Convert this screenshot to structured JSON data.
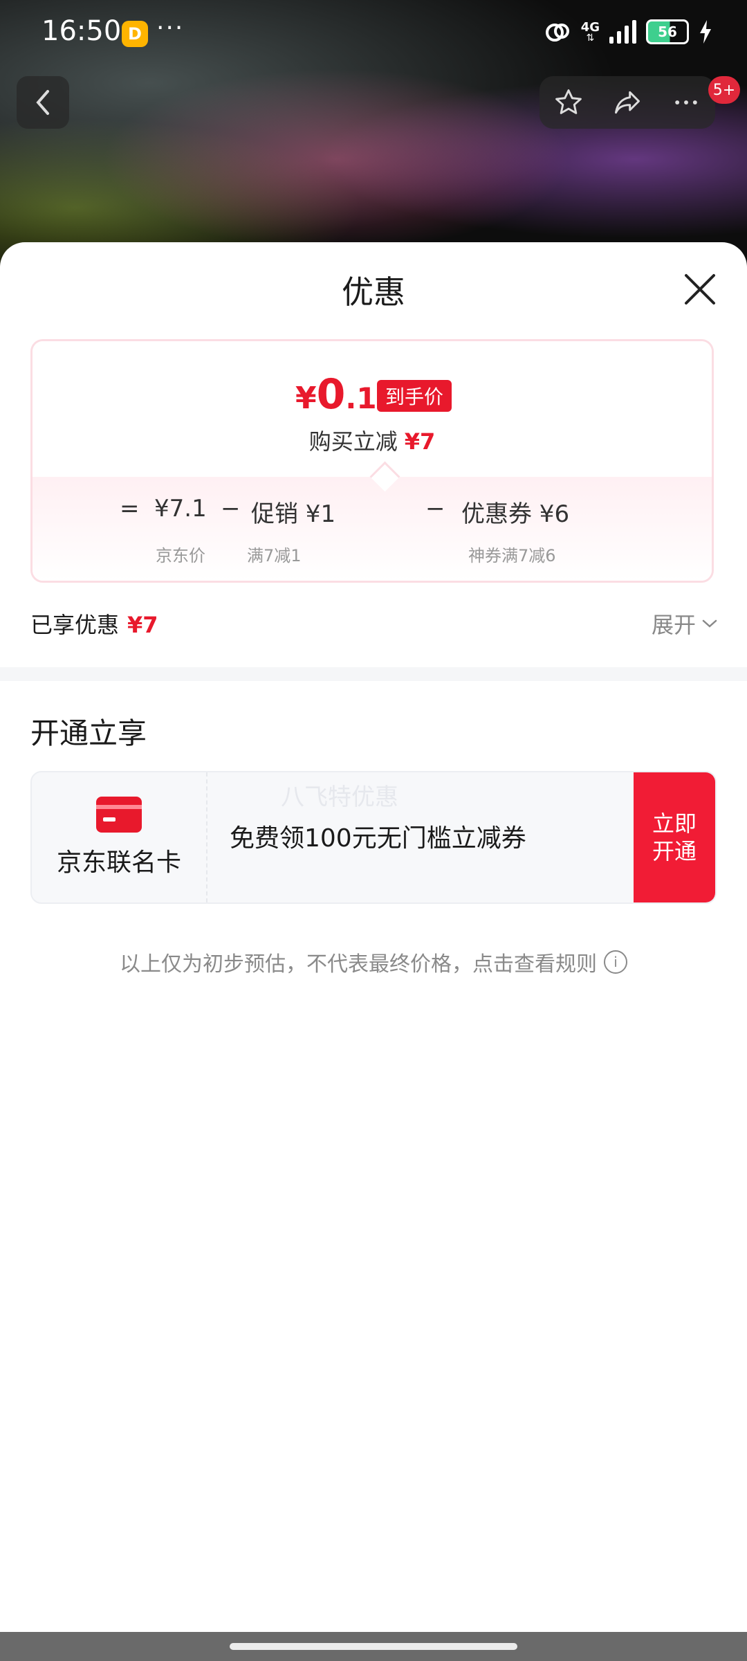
{
  "status_bar": {
    "time": "16:50",
    "app_badge": "D",
    "dots": "···",
    "network": "4G",
    "battery": "56"
  },
  "top_nav": {
    "message_badge": "5+",
    "icons": [
      "back-icon",
      "star-icon",
      "share-icon",
      "more-icon"
    ]
  },
  "sheet": {
    "title": "优惠",
    "price_card": {
      "currency": "¥",
      "final_int": "0",
      "final_dec": ".1",
      "final_tag": "到手价",
      "reduce_label": "购买立减",
      "reduce_value": "¥7",
      "eq": "=",
      "minus": "−",
      "jd_price": "¥7.1",
      "jd_price_label": "京东价",
      "promo": "促销 ¥1",
      "promo_label": "满7减1",
      "coupon": "优惠券 ¥6",
      "coupon_label": "神券满7减6"
    },
    "enjoyed": {
      "label": "已享优惠",
      "value": "¥7"
    },
    "expand_label": "展开",
    "section_title": "开通立享",
    "promo_card": {
      "card_name": "京东联名卡",
      "text": "免费领100元无门槛立减券",
      "watermark": "八飞特优惠",
      "button_line1": "立即",
      "button_line2": "开通"
    },
    "disclaimer": "以上仅为初步预估，不代表最终价格，点击查看规则"
  },
  "colors": {
    "accent_red": "#e8192c",
    "button_red": "#f11c35",
    "text_dark": "#1a1a1a",
    "text_gray": "#8a8a8a"
  }
}
